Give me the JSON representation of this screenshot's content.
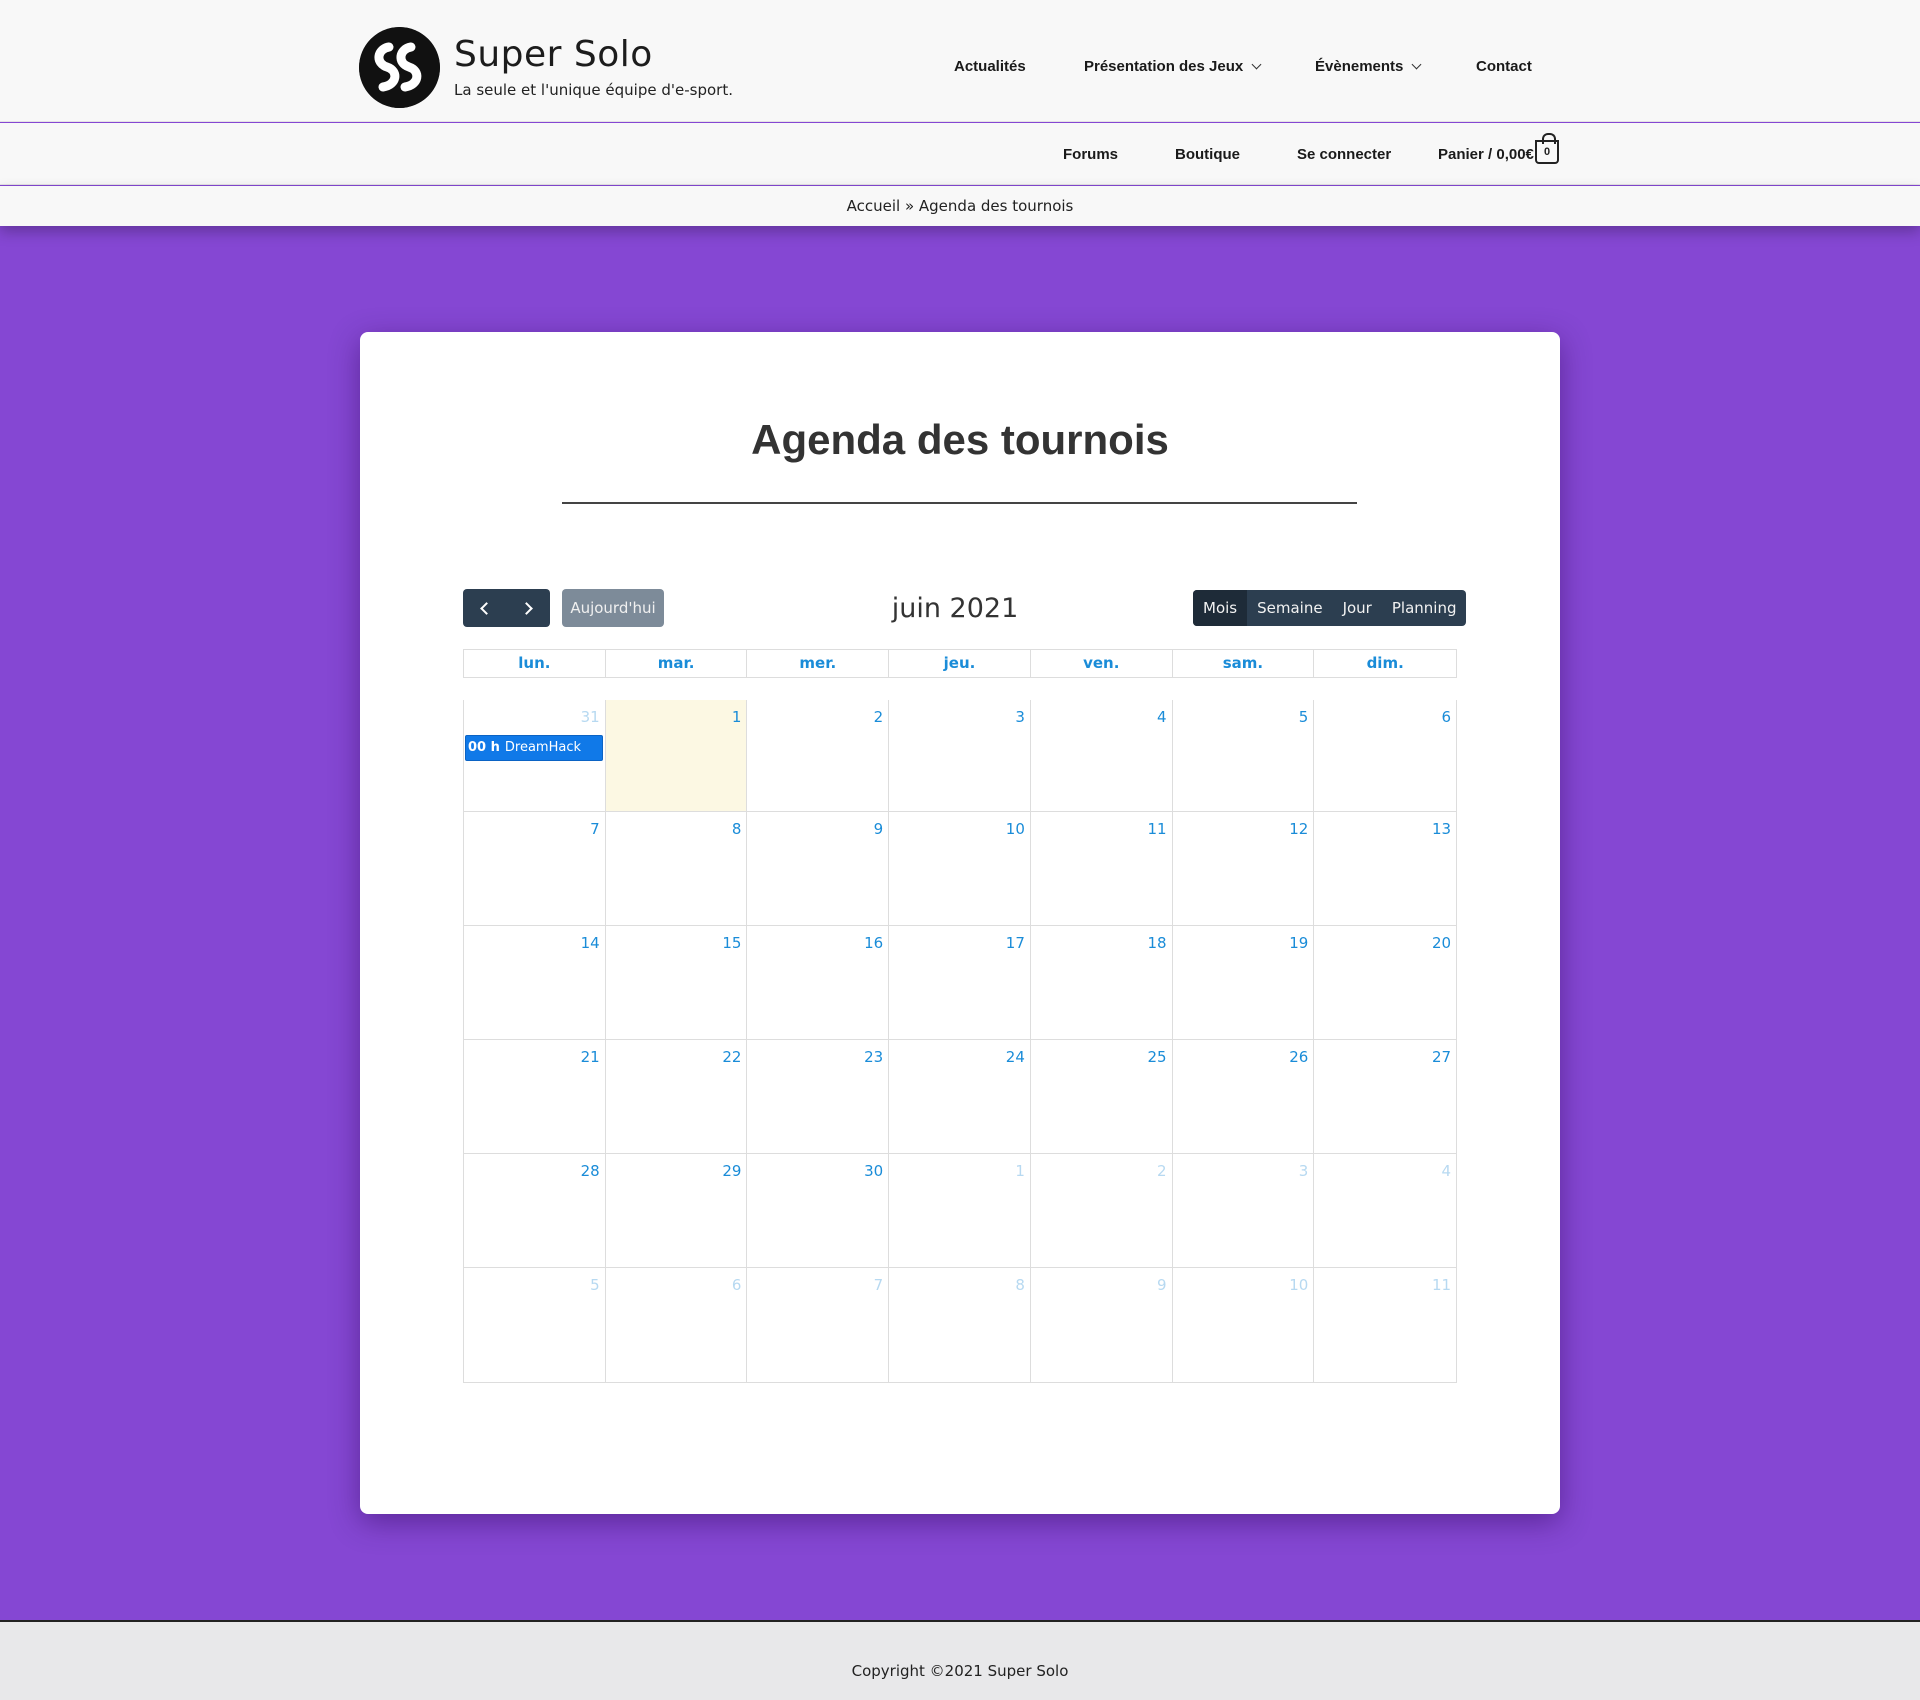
{
  "site": {
    "title": "Super Solo",
    "tagline": "La seule et l'unique équipe d'e-sport."
  },
  "nav": {
    "main": [
      "Actualités",
      "Présentation des Jeux",
      "Évènements",
      "Contact"
    ],
    "secondary": [
      "Forums",
      "Boutique",
      "Se connecter"
    ],
    "cart_label": "Panier / 0,00€",
    "cart_count": "0"
  },
  "breadcrumb": "Accueil » Agenda des tournois",
  "page": {
    "title": "Agenda des tournois"
  },
  "calendar": {
    "today_label": "Aujourd'hui",
    "month_title": "juin 2021",
    "views": [
      "Mois",
      "Semaine",
      "Jour",
      "Planning"
    ],
    "active_view": "Mois",
    "weekdays": [
      "lun.",
      "mar.",
      "mer.",
      "jeu.",
      "ven.",
      "sam.",
      "dim."
    ],
    "weeks": [
      [
        "31",
        "1",
        "2",
        "3",
        "4",
        "5",
        "6"
      ],
      [
        "7",
        "8",
        "9",
        "10",
        "11",
        "12",
        "13"
      ],
      [
        "14",
        "15",
        "16",
        "17",
        "18",
        "19",
        "20"
      ],
      [
        "21",
        "22",
        "23",
        "24",
        "25",
        "26",
        "27"
      ],
      [
        "28",
        "29",
        "30",
        "1",
        "2",
        "3",
        "4"
      ],
      [
        "5",
        "6",
        "7",
        "8",
        "9",
        "10",
        "11"
      ]
    ],
    "event": {
      "time": "00 h",
      "title": "DreamHack"
    }
  },
  "footer": {
    "copyright": "Copyright ©2021 Super Solo"
  },
  "colors": {
    "background": "#8547d3",
    "accent_blue": "#1a8cd8",
    "event_blue": "#1079e8",
    "dark_button": "#2c3e50",
    "today_highlight": "#fcf8e3"
  }
}
